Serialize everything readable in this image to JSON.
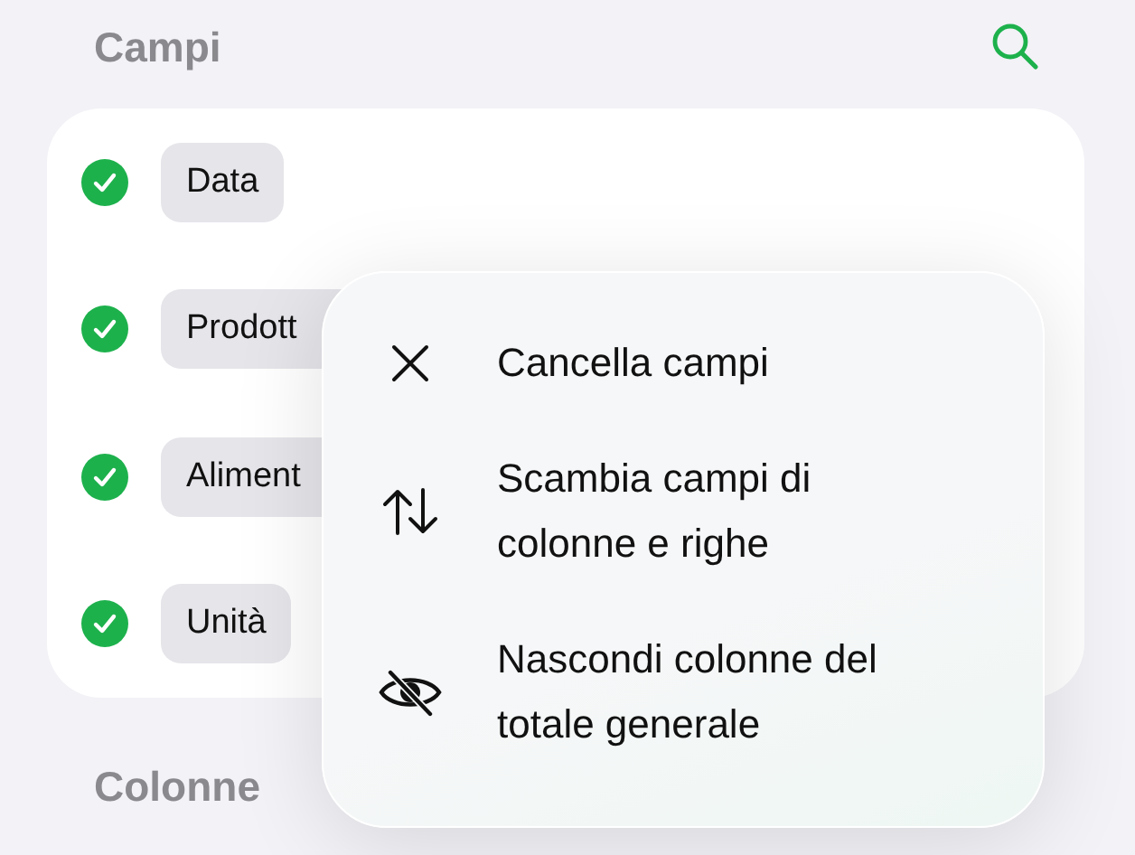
{
  "header": {
    "title": "Campi"
  },
  "fields": [
    {
      "label": "Data",
      "checked": true
    },
    {
      "label": "Prodott",
      "checked": true
    },
    {
      "label": "Aliment",
      "checked": true
    },
    {
      "label": "Unità",
      "checked": true
    }
  ],
  "next_section": {
    "title": "Colonne"
  },
  "menu": {
    "items": [
      {
        "kind": "clear",
        "label": "Cancella campi"
      },
      {
        "kind": "swap",
        "label": "Scambia campi di colonne e righe"
      },
      {
        "kind": "hide",
        "label": "Nascondi colonne del totale generale"
      }
    ]
  }
}
